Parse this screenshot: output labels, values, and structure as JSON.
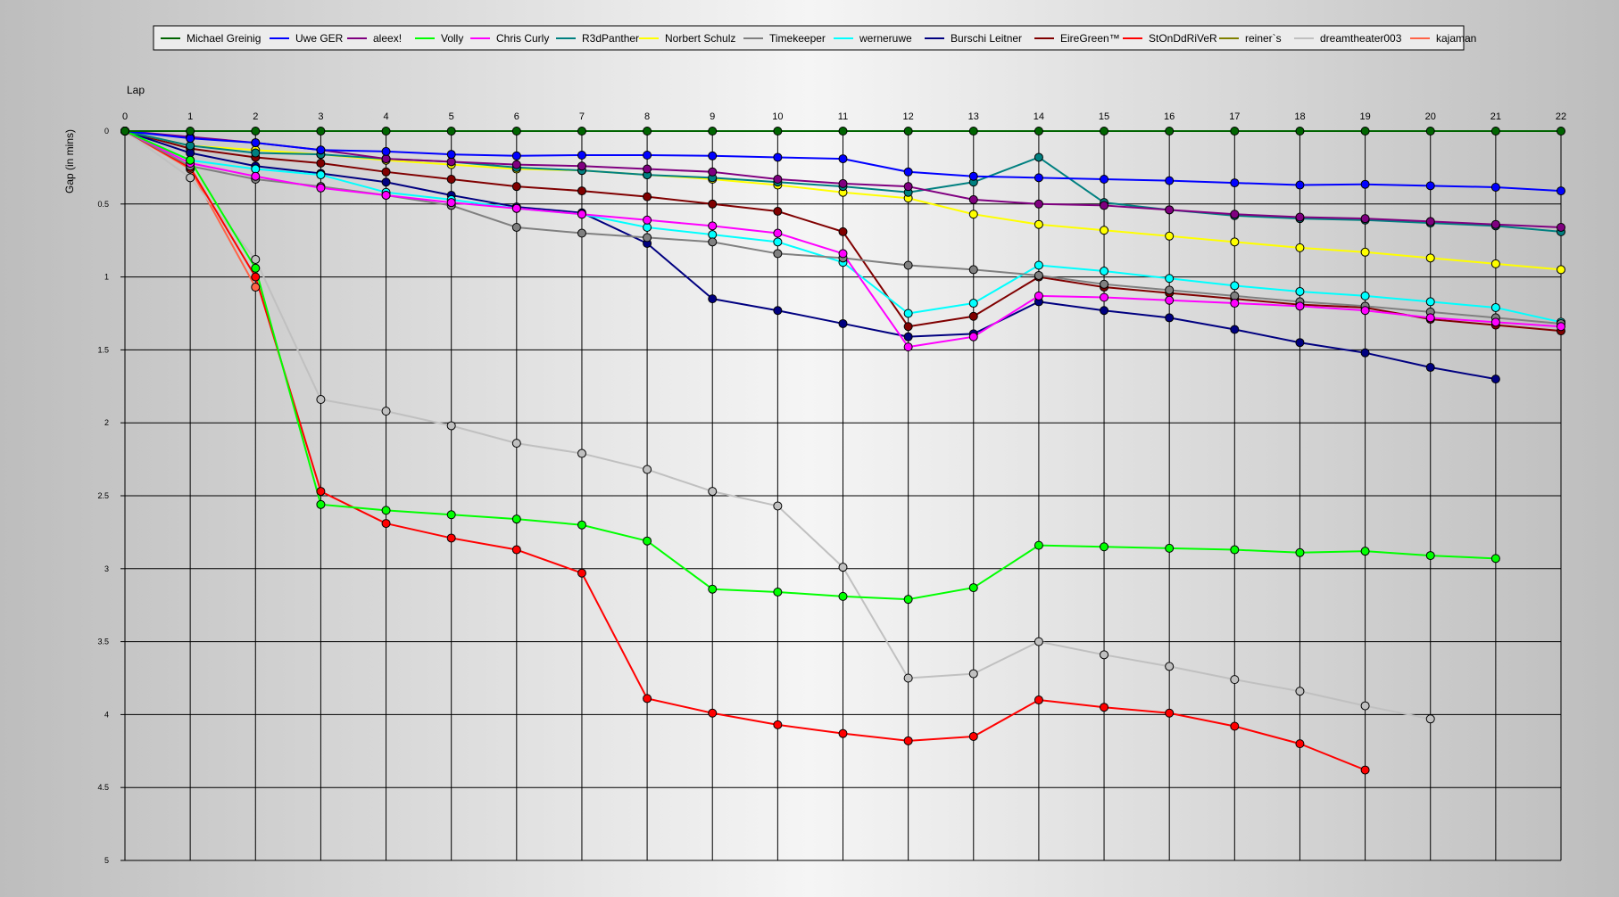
{
  "chart_data": {
    "type": "line",
    "xlabel": "Lap",
    "ylabel": "Gap (in mins)",
    "x": [
      0,
      1,
      2,
      3,
      4,
      5,
      6,
      7,
      8,
      9,
      10,
      11,
      12,
      13,
      14,
      15,
      16,
      17,
      18,
      19,
      20,
      21,
      22
    ],
    "x_ticks": [
      "0",
      "1",
      "2",
      "3",
      "4",
      "5",
      "6",
      "7",
      "8",
      "9",
      "10",
      "11",
      "12",
      "13",
      "14",
      "15",
      "16",
      "17",
      "18",
      "19",
      "20",
      "21",
      "22"
    ],
    "y_ticks": [
      {
        "value": 0,
        "label": "0"
      },
      {
        "value": 0.5,
        "label": "0.5"
      },
      {
        "value": 1,
        "label": "1"
      },
      {
        "value": 1.5,
        "label": "1.5"
      },
      {
        "value": 2,
        "label": "2"
      },
      {
        "value": 2.5,
        "label": "2.5"
      },
      {
        "value": 3,
        "label": "3"
      },
      {
        "value": 3.5,
        "label": "3.5"
      },
      {
        "value": 4,
        "label": "4"
      },
      {
        "value": 4.5,
        "label": "4.5"
      },
      {
        "value": 5,
        "label": "5"
      }
    ],
    "xlim": [
      0,
      22
    ],
    "ylim": [
      0,
      5
    ],
    "y_inverted": true,
    "x_axis_position": "top",
    "grid": true,
    "legend_position": "top",
    "series": [
      {
        "name": "Michael Greinig",
        "color": "#006400",
        "values": [
          0,
          0,
          0,
          0,
          0,
          0,
          0,
          0,
          0,
          0,
          0,
          0,
          0,
          0,
          0,
          0,
          0,
          0,
          0,
          0,
          0,
          0,
          0
        ]
      },
      {
        "name": "Uwe GER",
        "color": "#0000ff",
        "values": [
          0,
          0.05,
          0.08,
          0.13,
          0.14,
          0.16,
          0.17,
          0.165,
          0.165,
          0.17,
          0.18,
          0.19,
          0.28,
          0.31,
          0.32,
          0.33,
          0.34,
          0.355,
          0.37,
          0.365,
          0.375,
          0.385,
          0.41
        ]
      },
      {
        "name": "aleex!",
        "color": "#800080",
        "values": [
          0,
          0.04,
          0.08,
          0.13,
          0.19,
          0.21,
          0.23,
          0.24,
          0.26,
          0.28,
          0.33,
          0.36,
          0.38,
          0.47,
          0.5,
          0.51,
          0.54,
          0.57,
          0.59,
          0.6,
          0.62,
          0.64,
          0.66
        ]
      },
      {
        "name": "Volly",
        "color": "#00ff00",
        "values": [
          0,
          0.2,
          0.94,
          2.56,
          2.6,
          2.63,
          2.66,
          2.7,
          2.81,
          3.14,
          3.16,
          3.19,
          3.21,
          3.13,
          2.84,
          2.85,
          2.86,
          2.87,
          2.89,
          2.88,
          2.91,
          2.93
        ]
      },
      {
        "name": "Chris Curly",
        "color": "#ff00ff",
        "values": [
          0,
          0.22,
          0.31,
          0.39,
          0.44,
          0.49,
          0.53,
          0.57,
          0.61,
          0.65,
          0.7,
          0.84,
          1.48,
          1.41,
          1.13,
          1.14,
          1.16,
          1.18,
          1.2,
          1.23,
          1.28,
          1.31,
          1.34
        ]
      },
      {
        "name": "R3dPanther",
        "color": "#008080",
        "values": [
          0,
          0.1,
          0.15,
          0.16,
          0.19,
          0.21,
          0.25,
          0.27,
          0.3,
          0.32,
          0.35,
          0.38,
          0.42,
          0.35,
          0.18,
          0.49,
          0.54,
          0.58,
          0.6,
          0.61,
          0.63,
          0.65,
          0.69
        ]
      },
      {
        "name": "Norbert Schulz",
        "color": "#ffff00",
        "values": [
          0,
          0.1,
          0.13,
          0.16,
          0.2,
          0.23,
          0.26,
          0.27,
          0.3,
          0.33,
          0.37,
          0.42,
          0.46,
          0.57,
          0.64,
          0.68,
          0.72,
          0.76,
          0.8,
          0.83,
          0.87,
          0.91,
          0.95
        ]
      },
      {
        "name": "Timekeeper",
        "color": "#808080",
        "values": [
          0,
          0.24,
          0.33,
          0.38,
          0.44,
          0.51,
          0.66,
          0.7,
          0.73,
          0.76,
          0.84,
          0.87,
          0.92,
          0.95,
          0.99,
          1.05,
          1.09,
          1.13,
          1.17,
          1.2,
          1.24,
          1.28,
          1.32
        ]
      },
      {
        "name": "werneruwe",
        "color": "#00ffff",
        "values": [
          0,
          0.2,
          0.26,
          0.3,
          0.42,
          0.47,
          0.53,
          0.57,
          0.66,
          0.71,
          0.76,
          0.9,
          1.25,
          1.18,
          0.92,
          0.96,
          1.01,
          1.06,
          1.1,
          1.13,
          1.17,
          1.21,
          1.31
        ]
      },
      {
        "name": "Burschi Leitner",
        "color": "#000080",
        "values": [
          0,
          0.15,
          0.24,
          0.29,
          0.35,
          0.44,
          0.52,
          0.56,
          0.77,
          1.15,
          1.23,
          1.32,
          1.41,
          1.39,
          1.17,
          1.23,
          1.28,
          1.36,
          1.45,
          1.52,
          1.62,
          1.7
        ]
      },
      {
        "name": "EireGreen™",
        "color": "#800000",
        "values": [
          0,
          0.12,
          0.18,
          0.22,
          0.28,
          0.33,
          0.38,
          0.41,
          0.45,
          0.5,
          0.55,
          0.69,
          1.34,
          1.27,
          1.0,
          1.07,
          1.11,
          1.15,
          1.19,
          1.21,
          1.29,
          1.33,
          1.37
        ]
      },
      {
        "name": "StOnDdRiVeR",
        "color": "#ff0000",
        "values": [
          0,
          0.25,
          1.0,
          2.47,
          2.69,
          2.79,
          2.87,
          3.03,
          3.89,
          3.99,
          4.07,
          4.13,
          4.18,
          4.15,
          3.9,
          3.95,
          3.99,
          4.08,
          4.2,
          4.38
        ]
      },
      {
        "name": "reiner`s",
        "color": "#808000",
        "values": []
      },
      {
        "name": "dreamtheater003",
        "color": "#c0c0c0",
        "values": [
          0,
          0.32,
          0.88,
          1.84,
          1.92,
          2.02,
          2.14,
          2.21,
          2.32,
          2.47,
          2.57,
          2.99,
          3.75,
          3.72,
          3.5,
          3.59,
          3.67,
          3.76,
          3.84,
          3.94,
          4.03
        ]
      },
      {
        "name": "kajaman",
        "color": "#ff6347",
        "values": [
          0,
          0.26,
          1.07
        ]
      }
    ]
  }
}
